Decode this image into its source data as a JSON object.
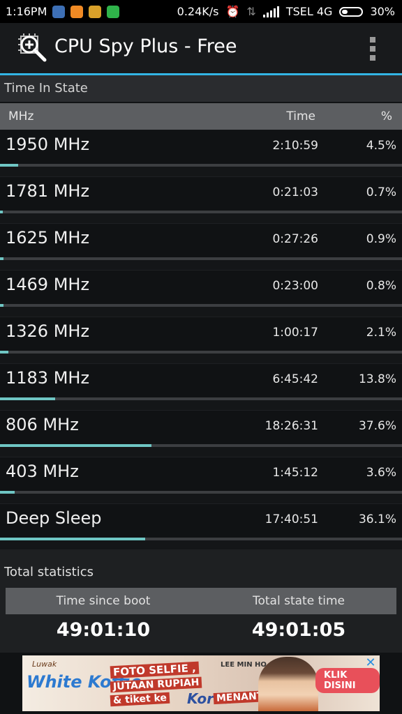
{
  "status_bar": {
    "time": "1:16PM",
    "net_speed": "0.24K/s",
    "carrier": "TSEL 4G",
    "battery": "30%",
    "icons": [
      "bbm-icon",
      "chat-bubble-icon",
      "game-icon",
      "line-icon",
      "alarm-icon",
      "data-arrows-icon",
      "signal-icon",
      "battery-icon"
    ]
  },
  "app_bar": {
    "title": "CPU Spy Plus - Free",
    "icon": "cpu-magnifier-icon",
    "overflow_icon": "overflow-menu-icon"
  },
  "time_in_state": {
    "header": "Time In State",
    "columns": {
      "freq": "MHz",
      "time": "Time",
      "percent": "%"
    },
    "rows": [
      {
        "label": "1950 MHz",
        "time": "2:10:59",
        "percent": "4.5%",
        "fraction": 0.045
      },
      {
        "label": "1781 MHz",
        "time": "0:21:03",
        "percent": "0.7%",
        "fraction": 0.007
      },
      {
        "label": "1625 MHz",
        "time": "0:27:26",
        "percent": "0.9%",
        "fraction": 0.009
      },
      {
        "label": "1469 MHz",
        "time": "0:23:00",
        "percent": "0.8%",
        "fraction": 0.008
      },
      {
        "label": "1326 MHz",
        "time": "1:00:17",
        "percent": "2.1%",
        "fraction": 0.021
      },
      {
        "label": "1183 MHz",
        "time": "6:45:42",
        "percent": "13.8%",
        "fraction": 0.138
      },
      {
        "label": "806 MHz",
        "time": "18:26:31",
        "percent": "37.6%",
        "fraction": 0.376
      },
      {
        "label": "403 MHz",
        "time": "1:45:12",
        "percent": "3.6%",
        "fraction": 0.036
      },
      {
        "label": "Deep Sleep",
        "time": "17:40:51",
        "percent": "36.1%",
        "fraction": 0.361
      }
    ],
    "bar_color": "#6fc6c4"
  },
  "total_statistics": {
    "header": "Total statistics",
    "since_boot_label": "Time since boot",
    "since_boot_value": "49:01:10",
    "state_time_label": "Total state time",
    "state_time_value": "49:01:05"
  },
  "ad": {
    "brand_small": "Luwak",
    "brand": "White Koffie",
    "line1": "FOTO SELFIE ,",
    "line2": "JUTAAN RUPIAH",
    "line3": "& tiket ke",
    "korea": "Korea",
    "line4": "MENANTI",
    "celebrity": "LEE MIN HO",
    "cta": "KLIK DISINI",
    "close_glyph": "✕"
  },
  "colors": {
    "accent": "#33b5e5",
    "header_gray": "#5c5e61"
  }
}
